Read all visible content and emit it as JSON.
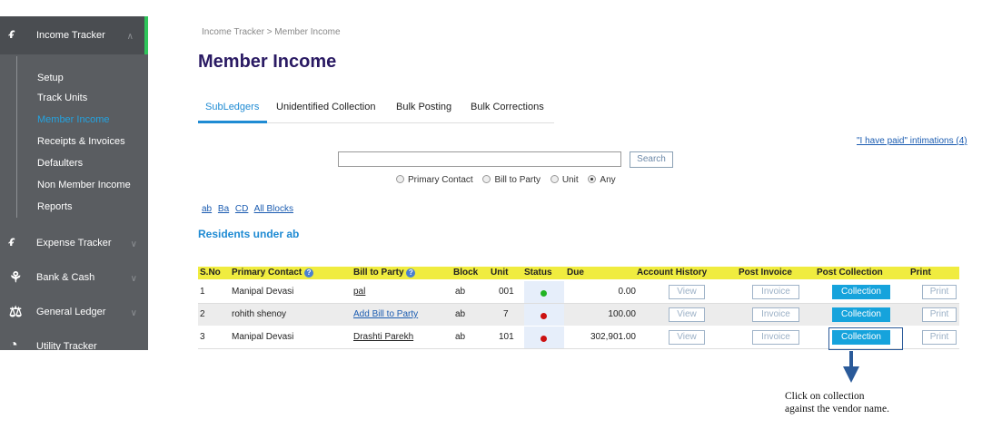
{
  "sidebar": {
    "header": {
      "label": "Income Tracker",
      "icon": "income-icon"
    },
    "items": [
      {
        "label": "Setup"
      },
      {
        "label": "Track Units"
      },
      {
        "label": "Member Income",
        "active": true
      },
      {
        "label": "Receipts & Invoices"
      },
      {
        "label": "Defaulters"
      },
      {
        "label": "Non Member Income"
      },
      {
        "label": "Reports"
      }
    ],
    "sections": [
      {
        "label": "Expense Tracker",
        "icon": "expense-icon"
      },
      {
        "label": "Bank & Cash",
        "icon": "piggy-bank-icon"
      },
      {
        "label": "General Ledger",
        "icon": "scale-icon"
      },
      {
        "label": "Utility Tracker",
        "icon": "gauge-icon"
      }
    ],
    "accent_color": "#2ec55a"
  },
  "breadcrumb": "Income Tracker > Member Income",
  "page_title": "Member Income",
  "tabs": [
    {
      "label": "SubLedgers",
      "active": true
    },
    {
      "label": "Unidentified Collection"
    },
    {
      "label": "Bulk Posting"
    },
    {
      "label": "Bulk Corrections"
    }
  ],
  "paid_link": "\"I have paid\" intimations (4)",
  "search": {
    "value": "",
    "button_label": "Search"
  },
  "radio_options": [
    {
      "label": "Primary Contact",
      "checked": false
    },
    {
      "label": "Bill to Party",
      "checked": false
    },
    {
      "label": "Unit",
      "checked": false
    },
    {
      "label": "Any",
      "checked": true
    }
  ],
  "block_links": [
    "ab",
    "Ba",
    "CD",
    "All Blocks"
  ],
  "residents_heading": "Residents under ab",
  "table": {
    "headers": [
      "S.No",
      "Primary Contact",
      "Bill to Party",
      "Block",
      "Unit",
      "Status",
      "Due",
      "Account History",
      "Post Invoice",
      "Post Collection",
      "Print"
    ],
    "rows": [
      {
        "sno": "1",
        "contact": "Manipal Devasi",
        "bill_to": "pal",
        "bill_to_is_link": false,
        "block": "ab",
        "unit": "001",
        "status": "green",
        "due": "0.00",
        "history": "View",
        "invoice": "Invoice",
        "collection": "Collection",
        "print": "Print"
      },
      {
        "sno": "2",
        "contact": "rohith shenoy",
        "bill_to": "Add Bill to Party",
        "bill_to_is_link": true,
        "block": "ab",
        "unit": "7",
        "status": "red",
        "due": "100.00",
        "history": "View",
        "invoice": "Invoice",
        "collection": "Collection",
        "print": "Print"
      },
      {
        "sno": "3",
        "contact": "Manipal Devasi",
        "bill_to": "Drashti Parekh",
        "bill_to_is_link": false,
        "block": "ab",
        "unit": "101",
        "status": "red",
        "due": "302,901.00",
        "history": "View",
        "invoice": "Invoice",
        "collection": "Collection",
        "print": "Print"
      }
    ],
    "header_color": "#f0ec3f",
    "status_colors": {
      "green": "#22b422",
      "red": "#cc1111"
    }
  },
  "annotation": {
    "line1": "Click on collection",
    "line2": "against the vendor name."
  }
}
